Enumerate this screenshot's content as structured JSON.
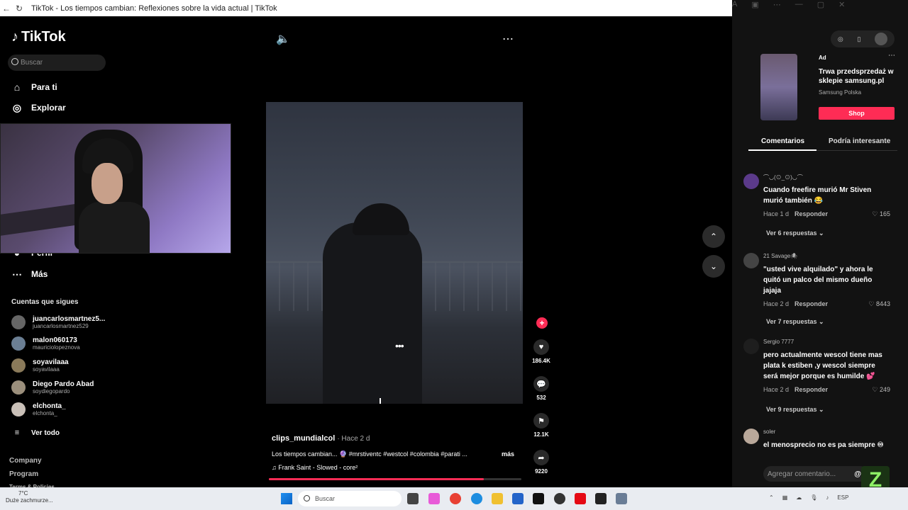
{
  "window": {
    "title": "TikTok - Los tiempos cambian: Reflexiones sobre la vida actual | TikTok"
  },
  "sidebar": {
    "logo": "TikTok",
    "search_placeholder": "Buscar",
    "nav": [
      {
        "label": "Para ti",
        "icon": "home-icon"
      },
      {
        "label": "Explorar",
        "icon": "compass-icon"
      },
      {
        "label": "Perfil",
        "icon": "user-icon"
      },
      {
        "label": "Más",
        "icon": "more-icon"
      }
    ],
    "following_title": "Cuentas que sigues",
    "following": [
      {
        "name": "juancarlosmartnez5...",
        "handle": "juancarlosmartnez529"
      },
      {
        "name": "malon060173",
        "handle": "mauriciolopeznova"
      },
      {
        "name": "soyavilaaa",
        "handle": "soyavilaaa"
      },
      {
        "name": "Diego Pardo Abad",
        "handle": "soydiegopardo"
      },
      {
        "name": "elchonta_",
        "handle": "elchonta_"
      }
    ],
    "see_all": "Ver todo",
    "footer": [
      "Company",
      "Program",
      "Terms & Policies"
    ]
  },
  "video": {
    "author": "clips_mundialcol",
    "time": "· Hace 2 d",
    "description": "Los tiempos cambian... 🔮 #mrstiventc #westcol #colombia #parati ...",
    "more": "más",
    "music": "♫ Frank Saint - Slowed - core²",
    "progress": 0.85,
    "likes": "186.4K",
    "comments": "532",
    "saves": "12.1K",
    "shares": "9220"
  },
  "ad": {
    "tag": "Ad",
    "headline": "Trwa przedsprzedaż w sklepie samsung.pl",
    "brand": "Samsung Polska",
    "button": "Shop"
  },
  "tabs": {
    "comments": "Comentarios",
    "interesting": "Podría interesante"
  },
  "comments": [
    {
      "user": "⌒◡(⊙_⊙)◡⌒",
      "text": "Cuando freefire murió Mr Stiven murió también 😂",
      "time": "Hace 1 d",
      "reply": "Responder",
      "likes": "165",
      "replies": "Ver 6 respuestas ⌄"
    },
    {
      "user": "21 Savage🕷",
      "text": "\"usted vive alquilado\" y ahora le quitó un palco del mismo dueño jajaja",
      "time": "Hace 2 d",
      "reply": "Responder",
      "likes": "8443",
      "replies": "Ver 7 respuestas ⌄"
    },
    {
      "user": "Sergio 7777",
      "text": "pero actualmente wescol tiene mas plata k estiben ,y wescol siempre será mejor porque es humilde 💕",
      "time": "Hace 2 d",
      "reply": "Responder",
      "likes": "249",
      "replies": "Ver 9 respuestas ⌄"
    },
    {
      "user": "soler",
      "text": "el menosprecio no es pa siempre ♾",
      "time": "",
      "reply": "",
      "likes": "",
      "replies": ""
    }
  ],
  "add_comment_placeholder": "Agregar comentario...",
  "taskbar": {
    "weather_temp": "7°C",
    "weather_desc": "Duże zachmurze...",
    "search": "Buscar",
    "lang": "ESP"
  },
  "colors": {
    "accent": "#fe2c55",
    "background": "#000000",
    "panel": "#121212"
  }
}
